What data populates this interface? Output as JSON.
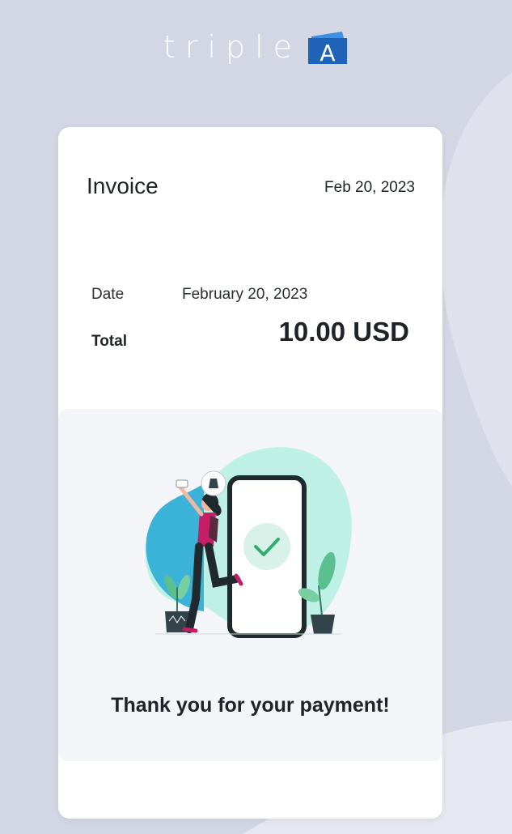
{
  "brand": {
    "logo_text": "triple",
    "logo_letter": "A"
  },
  "invoice": {
    "title": "Invoice",
    "header_date": "Feb 20, 2023",
    "date_label": "Date",
    "date_value": "February 20, 2023",
    "total_label": "Total",
    "total_value": "10.00 USD"
  },
  "confirmation": {
    "message": "Thank you for your payment!"
  },
  "colors": {
    "background": "#d3d7e4",
    "card": "#ffffff",
    "panel": "#f4f5f9",
    "accent_teal": "#5fd1c0",
    "brand_blue": "#1f63b8",
    "check_green": "#2fae6e"
  }
}
